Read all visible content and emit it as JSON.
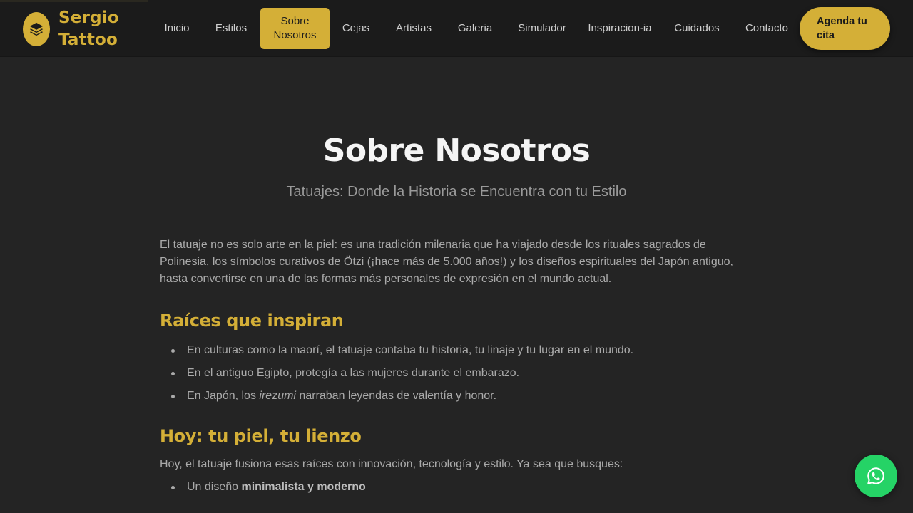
{
  "brand": {
    "name_line1": "Sergio",
    "name_line2": "Tattoo",
    "logo_icon": "layers-icon",
    "accent": "#d4af37"
  },
  "nav": {
    "items": [
      {
        "label": "Inicio"
      },
      {
        "label": "Estilos"
      },
      {
        "label": "Sobre Nosotros",
        "active": true
      },
      {
        "label": "Cejas"
      },
      {
        "label": "Artistas"
      },
      {
        "label": "Galeria"
      },
      {
        "label": "Simulador"
      },
      {
        "label": "Inspiracion-ia"
      },
      {
        "label": "Cuidados"
      },
      {
        "label": "Contacto"
      }
    ],
    "cta_label": "Agenda tu cita"
  },
  "hero": {
    "title": "Sobre Nosotros",
    "subtitle": "Tatuajes: Donde la Historia se Encuentra con tu Estilo"
  },
  "intro": "El tatuaje no es solo arte en la piel: es una tradición milenaria que ha viajado desde los rituales sagrados de Polinesia, los símbolos curativos de Ötzi (¡hace más de 5.000 años!) y los diseños espirituales del Japón antiguo, hasta convertirse en una de las formas más personales de expresión en el mundo actual.",
  "roots": {
    "heading": "Raíces que inspiran",
    "items": [
      {
        "text": "En culturas como la maorí, el tatuaje contaba tu historia, tu linaje y tu lugar en el mundo."
      },
      {
        "text": "En el antiguo Egipto, protegía a las mujeres durante el embarazo."
      },
      {
        "prefix": "En Japón, los ",
        "emphasis": "irezumi",
        "suffix": " narraban leyendas de valentía y honor."
      }
    ]
  },
  "today": {
    "heading": "Hoy: tu piel, tu lienzo",
    "intro": "Hoy, el tatuaje fusiona esas raíces con innovación, tecnología y estilo. Ya sea que busques:",
    "items": [
      {
        "prefix": "Un diseño ",
        "strong": "minimalista y moderno"
      }
    ]
  },
  "whatsapp": {
    "icon": "whatsapp-icon",
    "color": "#25d366"
  }
}
